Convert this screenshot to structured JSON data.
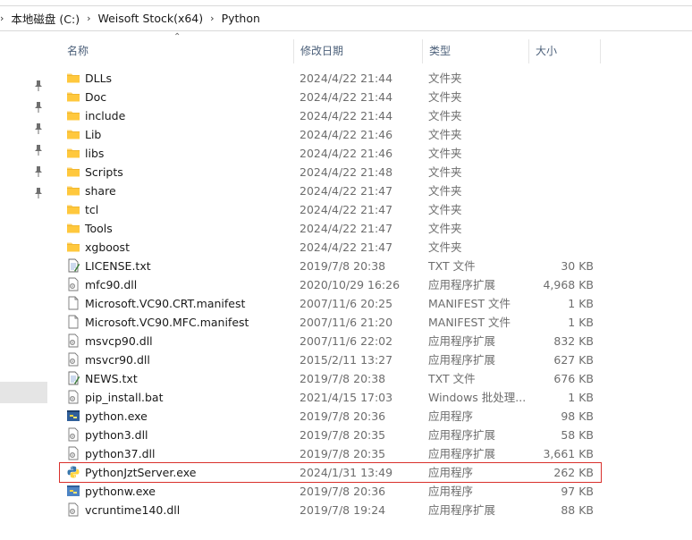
{
  "breadcrumb": [
    "本地磁盘 (C:)",
    "Weisoft Stock(x64)",
    "Python"
  ],
  "columns": {
    "name": "名称",
    "date": "修改日期",
    "type": "类型",
    "size": "大小"
  },
  "colors": {
    "highlight_border": "#d9302c",
    "folder": "#ffd166",
    "header_text": "#4c607a"
  },
  "files": [
    {
      "name": "DLLs",
      "date": "2024/4/22 21:44",
      "type": "文件夹",
      "size": "",
      "icon": "folder-icon"
    },
    {
      "name": "Doc",
      "date": "2024/4/22 21:44",
      "type": "文件夹",
      "size": "",
      "icon": "folder-icon"
    },
    {
      "name": "include",
      "date": "2024/4/22 21:44",
      "type": "文件夹",
      "size": "",
      "icon": "folder-icon"
    },
    {
      "name": "Lib",
      "date": "2024/4/22 21:46",
      "type": "文件夹",
      "size": "",
      "icon": "folder-icon"
    },
    {
      "name": "libs",
      "date": "2024/4/22 21:46",
      "type": "文件夹",
      "size": "",
      "icon": "folder-icon"
    },
    {
      "name": "Scripts",
      "date": "2024/4/22 21:48",
      "type": "文件夹",
      "size": "",
      "icon": "folder-icon"
    },
    {
      "name": "share",
      "date": "2024/4/22 21:47",
      "type": "文件夹",
      "size": "",
      "icon": "folder-icon"
    },
    {
      "name": "tcl",
      "date": "2024/4/22 21:47",
      "type": "文件夹",
      "size": "",
      "icon": "folder-icon"
    },
    {
      "name": "Tools",
      "date": "2024/4/22 21:47",
      "type": "文件夹",
      "size": "",
      "icon": "folder-icon"
    },
    {
      "name": "xgboost",
      "date": "2024/4/22 21:47",
      "type": "文件夹",
      "size": "",
      "icon": "folder-icon"
    },
    {
      "name": "LICENSE.txt",
      "date": "2019/7/8 20:38",
      "type": "TXT 文件",
      "size": "30 KB",
      "icon": "text-file-icon"
    },
    {
      "name": "mfc90.dll",
      "date": "2020/10/29 16:26",
      "type": "应用程序扩展",
      "size": "4,968 KB",
      "icon": "dll-file-icon"
    },
    {
      "name": "Microsoft.VC90.CRT.manifest",
      "date": "2007/11/6 20:25",
      "type": "MANIFEST 文件",
      "size": "1 KB",
      "icon": "blank-file-icon"
    },
    {
      "name": "Microsoft.VC90.MFC.manifest",
      "date": "2007/11/6 21:20",
      "type": "MANIFEST 文件",
      "size": "1 KB",
      "icon": "blank-file-icon"
    },
    {
      "name": "msvcp90.dll",
      "date": "2007/11/6 22:02",
      "type": "应用程序扩展",
      "size": "832 KB",
      "icon": "dll-file-icon"
    },
    {
      "name": "msvcr90.dll",
      "date": "2015/2/11 13:27",
      "type": "应用程序扩展",
      "size": "627 KB",
      "icon": "dll-file-icon"
    },
    {
      "name": "NEWS.txt",
      "date": "2019/7/8 20:38",
      "type": "TXT 文件",
      "size": "676 KB",
      "icon": "text-file-icon"
    },
    {
      "name": "pip_install.bat",
      "date": "2021/4/15 17:03",
      "type": "Windows 批处理...",
      "size": "1 KB",
      "icon": "bat-file-icon"
    },
    {
      "name": "python.exe",
      "date": "2019/7/8 20:36",
      "type": "应用程序",
      "size": "98 KB",
      "icon": "python-exe-icon"
    },
    {
      "name": "python3.dll",
      "date": "2019/7/8 20:35",
      "type": "应用程序扩展",
      "size": "58 KB",
      "icon": "dll-file-icon"
    },
    {
      "name": "python37.dll",
      "date": "2019/7/8 20:35",
      "type": "应用程序扩展",
      "size": "3,661 KB",
      "icon": "dll-file-icon"
    },
    {
      "name": "PythonJztServer.exe",
      "date": "2024/1/31 13:49",
      "type": "应用程序",
      "size": "262 KB",
      "icon": "python-logo-icon",
      "highlighted": true
    },
    {
      "name": "pythonw.exe",
      "date": "2019/7/8 20:36",
      "type": "应用程序",
      "size": "97 KB",
      "icon": "pythonw-exe-icon"
    },
    {
      "name": "vcruntime140.dll",
      "date": "2019/7/8 19:24",
      "type": "应用程序扩展",
      "size": "88 KB",
      "icon": "dll-file-icon"
    }
  ]
}
